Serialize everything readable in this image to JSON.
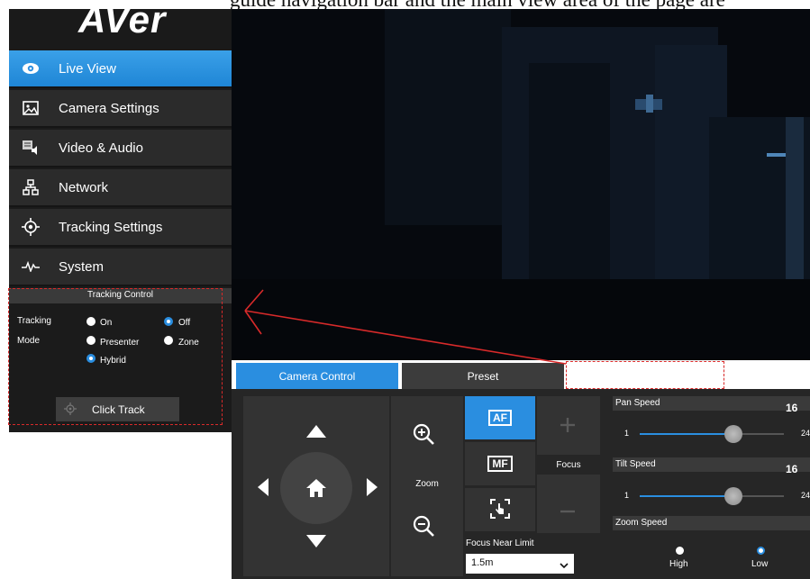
{
  "top_caption": "guide navigation bar and the main view area of the page are",
  "brand": {
    "logo": "AVer"
  },
  "sidebar": {
    "items": [
      {
        "label": "Live View",
        "icon": "eye-icon",
        "active": true
      },
      {
        "label": "Camera Settings",
        "icon": "image-icon",
        "active": false
      },
      {
        "label": "Video & Audio",
        "icon": "video-audio-icon",
        "active": false
      },
      {
        "label": "Network",
        "icon": "network-icon",
        "active": false
      },
      {
        "label": "Tracking Settings",
        "icon": "crosshair-icon",
        "active": false
      },
      {
        "label": "System",
        "icon": "pulse-icon",
        "active": false
      }
    ]
  },
  "tracking_control": {
    "title": "Tracking Control",
    "tracking_label": "Tracking",
    "tracking_options": [
      "On",
      "Off"
    ],
    "tracking_selected": "Off",
    "mode_label": "Mode",
    "mode_options": [
      "Presenter",
      "Zone",
      "Hybrid"
    ],
    "mode_selected": "Hybrid",
    "click_track_label": "Click Track"
  },
  "tabs": [
    {
      "label": "Camera Control",
      "active": true
    },
    {
      "label": "Preset",
      "active": false
    }
  ],
  "camera_control": {
    "zoom_label": "Zoom",
    "af_label": "AF",
    "mf_label": "MF",
    "focus_label": "Focus",
    "focus_near_limit_label": "Focus Near Limit",
    "focus_near_limit_value": "1.5m",
    "pan_speed": {
      "label": "Pan Speed",
      "value": "16",
      "min": "1",
      "max": "24"
    },
    "tilt_speed": {
      "label": "Tilt Speed",
      "value": "16",
      "min": "1",
      "max": "24"
    },
    "zoom_speed": {
      "label": "Zoom Speed",
      "options": [
        "High",
        "Low"
      ],
      "selected": "Low"
    }
  },
  "colors": {
    "accent": "#2a8ee0",
    "sidebar_bg": "#1b1b1b",
    "panel_bg": "#262626",
    "annotation": "#d82a2a"
  }
}
